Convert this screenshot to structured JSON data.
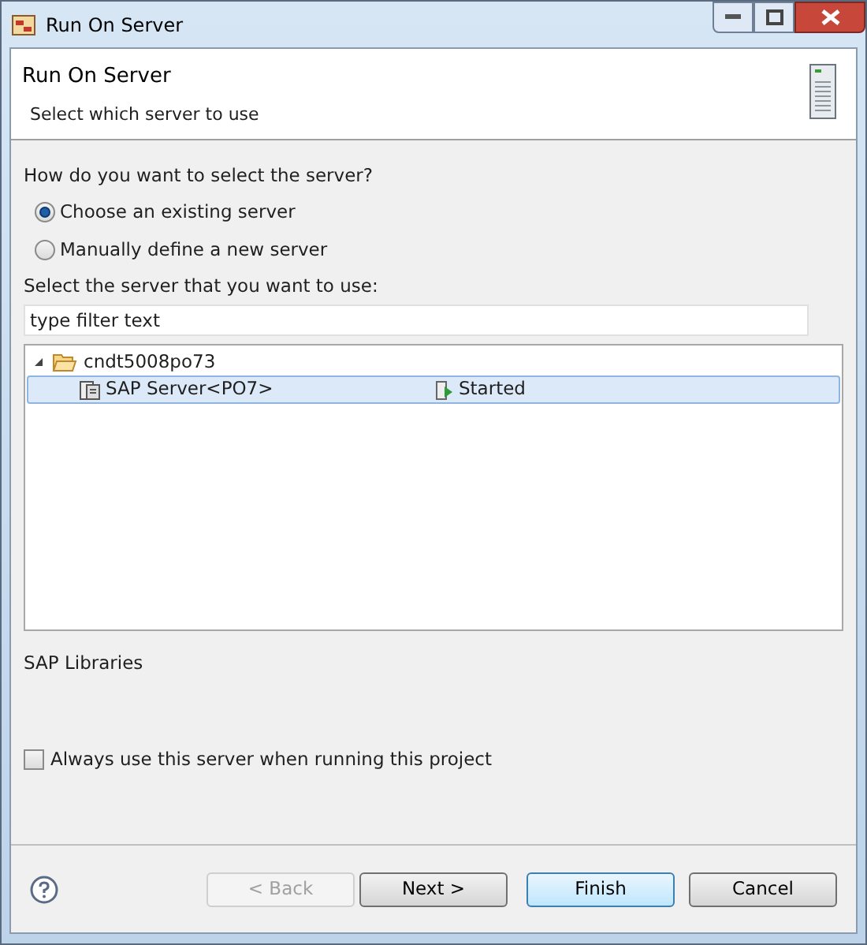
{
  "window": {
    "title": "Run On Server"
  },
  "header": {
    "title": "Run On Server",
    "subtitle": "Select which server to use"
  },
  "question": "How do you want to select the server?",
  "radios": [
    {
      "label": "Choose an existing server",
      "selected": true
    },
    {
      "label": "Manually define a new server",
      "selected": false
    }
  ],
  "server_prompt": "Select the server that you want to use:",
  "filter": {
    "placeholder": "type filter text"
  },
  "tree": [
    {
      "label": "cndt5008po73",
      "expanded": true,
      "children": [
        {
          "label": "SAP Server<PO7>",
          "state": "Started",
          "selected": true
        }
      ]
    }
  ],
  "details": "SAP Libraries",
  "always_use": {
    "label": "Always use this server when running this project",
    "checked": false
  },
  "buttons": [
    {
      "label": "< Back",
      "disabled": true,
      "default": false
    },
    {
      "label": "Next >",
      "disabled": false,
      "default": false
    },
    {
      "label": "Finish",
      "disabled": false,
      "default": true
    },
    {
      "label": "Cancel",
      "disabled": false,
      "default": false
    }
  ]
}
